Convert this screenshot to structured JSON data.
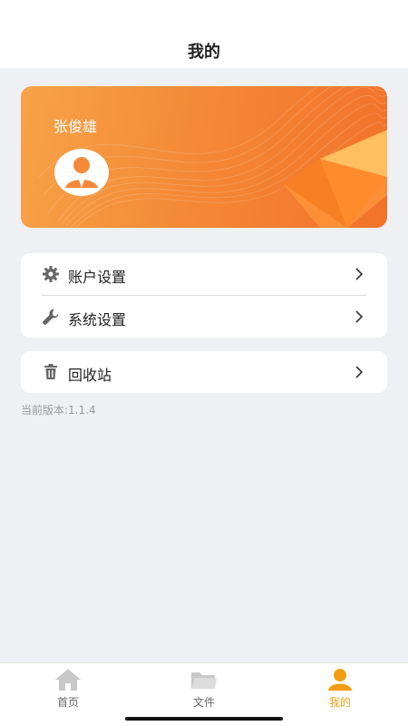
{
  "header": {
    "title": "我的"
  },
  "profile": {
    "name": "张俊雄",
    "avatar_icon": "user-avatar-icon"
  },
  "menu": {
    "group1": [
      {
        "label": "账户设置",
        "icon": "gear-icon"
      },
      {
        "label": "系统设置",
        "icon": "wrench-icon"
      }
    ],
    "group2": [
      {
        "label": "回收站",
        "icon": "trash-icon"
      }
    ]
  },
  "version": "当前版本:1.1.4",
  "tabs": [
    {
      "label": "首页",
      "icon": "home-icon",
      "active": false
    },
    {
      "label": "文件",
      "icon": "folder-icon",
      "active": false
    },
    {
      "label": "我的",
      "icon": "person-icon",
      "active": true
    }
  ],
  "colors": {
    "accent": "#f39c12",
    "card_start": "#f7a347",
    "card_end": "#f2722a"
  }
}
